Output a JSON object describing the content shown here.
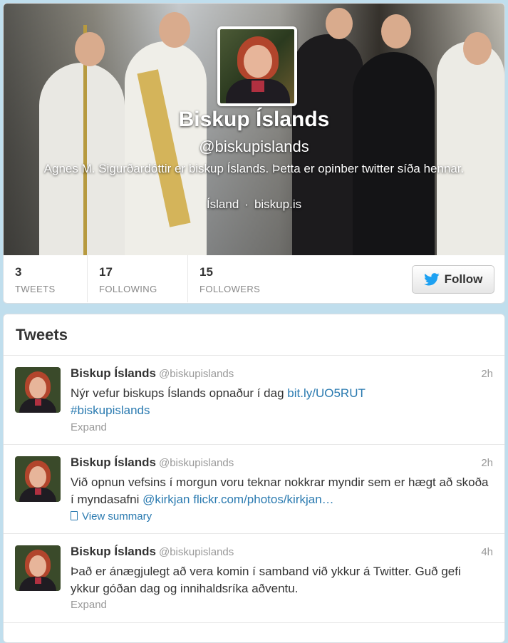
{
  "profile": {
    "name": "Biskup Íslands",
    "handle": "@biskupislands",
    "bio": "Agnes M. Sigurðardóttir er biskup Íslands. Þetta er opinber twitter síða hennar.",
    "location": "Ísland",
    "separator": "·",
    "website": "biskup.is"
  },
  "stats": [
    {
      "value": "3",
      "label": "TWEETS"
    },
    {
      "value": "17",
      "label": "FOLLOWING"
    },
    {
      "value": "15",
      "label": "FOLLOWERS"
    }
  ],
  "follow_button": {
    "label": "Follow",
    "icon": "twitter-bird-icon"
  },
  "tweets_section": {
    "title": "Tweets"
  },
  "tweets": [
    {
      "author": "Biskup Íslands",
      "handle": "@biskupislands",
      "time": "2h",
      "text": "Nýr vefur biskups Íslands opnaður í dag ",
      "link": "bit.ly/UO5RUT",
      "hashtag": "#biskupislands",
      "action": "Expand"
    },
    {
      "author": "Biskup Íslands",
      "handle": "@biskupislands",
      "time": "2h",
      "text": "Við opnun vefsins í morgun voru teknar nokkrar myndir sem er hægt að skoða í myndasafni ",
      "mention": "@kirkjan",
      "link": "flickr.com/photos/kirkjan…",
      "action": "View summary",
      "action_icon": "document-icon"
    },
    {
      "author": "Biskup Íslands",
      "handle": "@biskupislands",
      "time": "4h",
      "text": "Það er ánægjulegt að vera komin í samband við ykkur á Twitter. Guð gefi ykkur góðan dag og innihaldsríka aðventu.",
      "action": "Expand"
    }
  ],
  "colors": {
    "background": "#c0deed",
    "link": "#2a7ab0",
    "twitter_blue": "#1da1f2"
  }
}
